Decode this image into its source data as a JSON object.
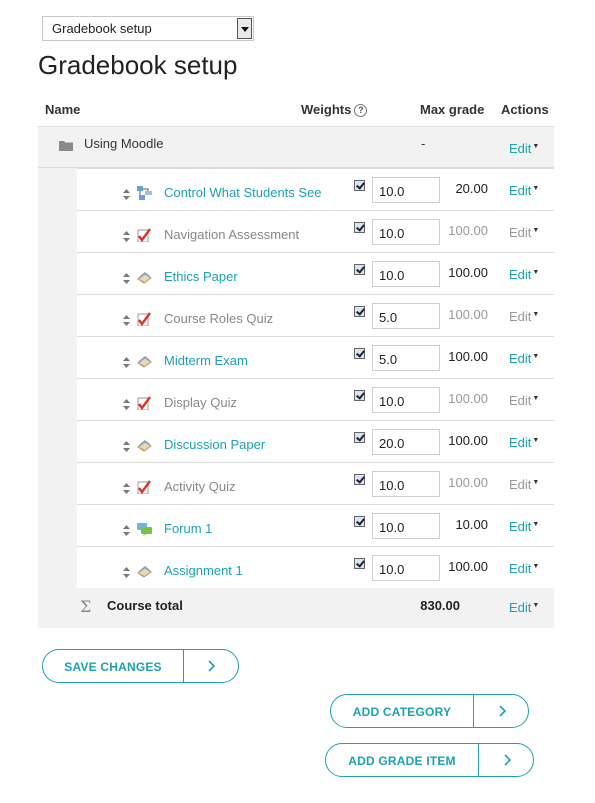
{
  "top_select": {
    "value": "Gradebook setup"
  },
  "page_title": "Gradebook setup",
  "table": {
    "headers": {
      "name": "Name",
      "weights": "Weights",
      "max_grade": "Max grade",
      "actions": "Actions"
    },
    "category": {
      "name": "Using Moodle",
      "max_grade": "-",
      "action": "Edit"
    },
    "items": [
      {
        "name": "Control What Students See",
        "type": "lesson",
        "hidden": false,
        "weight_checked": true,
        "weight": "10.0",
        "max_grade": "20.00",
        "action": "Edit"
      },
      {
        "name": "Navigation Assessment",
        "type": "quiz",
        "hidden": true,
        "weight_checked": true,
        "weight": "10.0",
        "max_grade": "100.00",
        "action": "Edit"
      },
      {
        "name": "Ethics Paper",
        "type": "assignment",
        "hidden": false,
        "weight_checked": true,
        "weight": "10.0",
        "max_grade": "100.00",
        "action": "Edit"
      },
      {
        "name": "Course Roles Quiz",
        "type": "quiz",
        "hidden": true,
        "weight_checked": true,
        "weight": "5.0",
        "max_grade": "100.00",
        "action": "Edit"
      },
      {
        "name": "Midterm Exam",
        "type": "assignment",
        "hidden": false,
        "weight_checked": true,
        "weight": "5.0",
        "max_grade": "100.00",
        "action": "Edit"
      },
      {
        "name": "Display Quiz",
        "type": "quiz",
        "hidden": true,
        "weight_checked": true,
        "weight": "10.0",
        "max_grade": "100.00",
        "action": "Edit"
      },
      {
        "name": "Discussion Paper",
        "type": "assignment",
        "hidden": false,
        "weight_checked": true,
        "weight": "20.0",
        "max_grade": "100.00",
        "action": "Edit"
      },
      {
        "name": "Activity Quiz",
        "type": "quiz",
        "hidden": true,
        "weight_checked": true,
        "weight": "10.0",
        "max_grade": "100.00",
        "action": "Edit"
      },
      {
        "name": "Forum 1",
        "type": "forum",
        "hidden": false,
        "weight_checked": true,
        "weight": "10.0",
        "max_grade": "10.00",
        "action": "Edit"
      },
      {
        "name": "Assignment 1",
        "type": "assignment",
        "hidden": false,
        "weight_checked": true,
        "weight": "10.0",
        "max_grade": "100.00",
        "action": "Edit"
      }
    ],
    "total": {
      "label": "Course total",
      "max_grade": "830.00",
      "action": "Edit"
    }
  },
  "buttons": {
    "save_changes": "SAVE CHANGES",
    "add_category": "ADD CATEGORY",
    "add_grade_item": "ADD GRADE ITEM"
  },
  "colors": {
    "accent": "#1ba1b3",
    "dim_text": "#888888",
    "row_background": "#f2f2f2"
  }
}
